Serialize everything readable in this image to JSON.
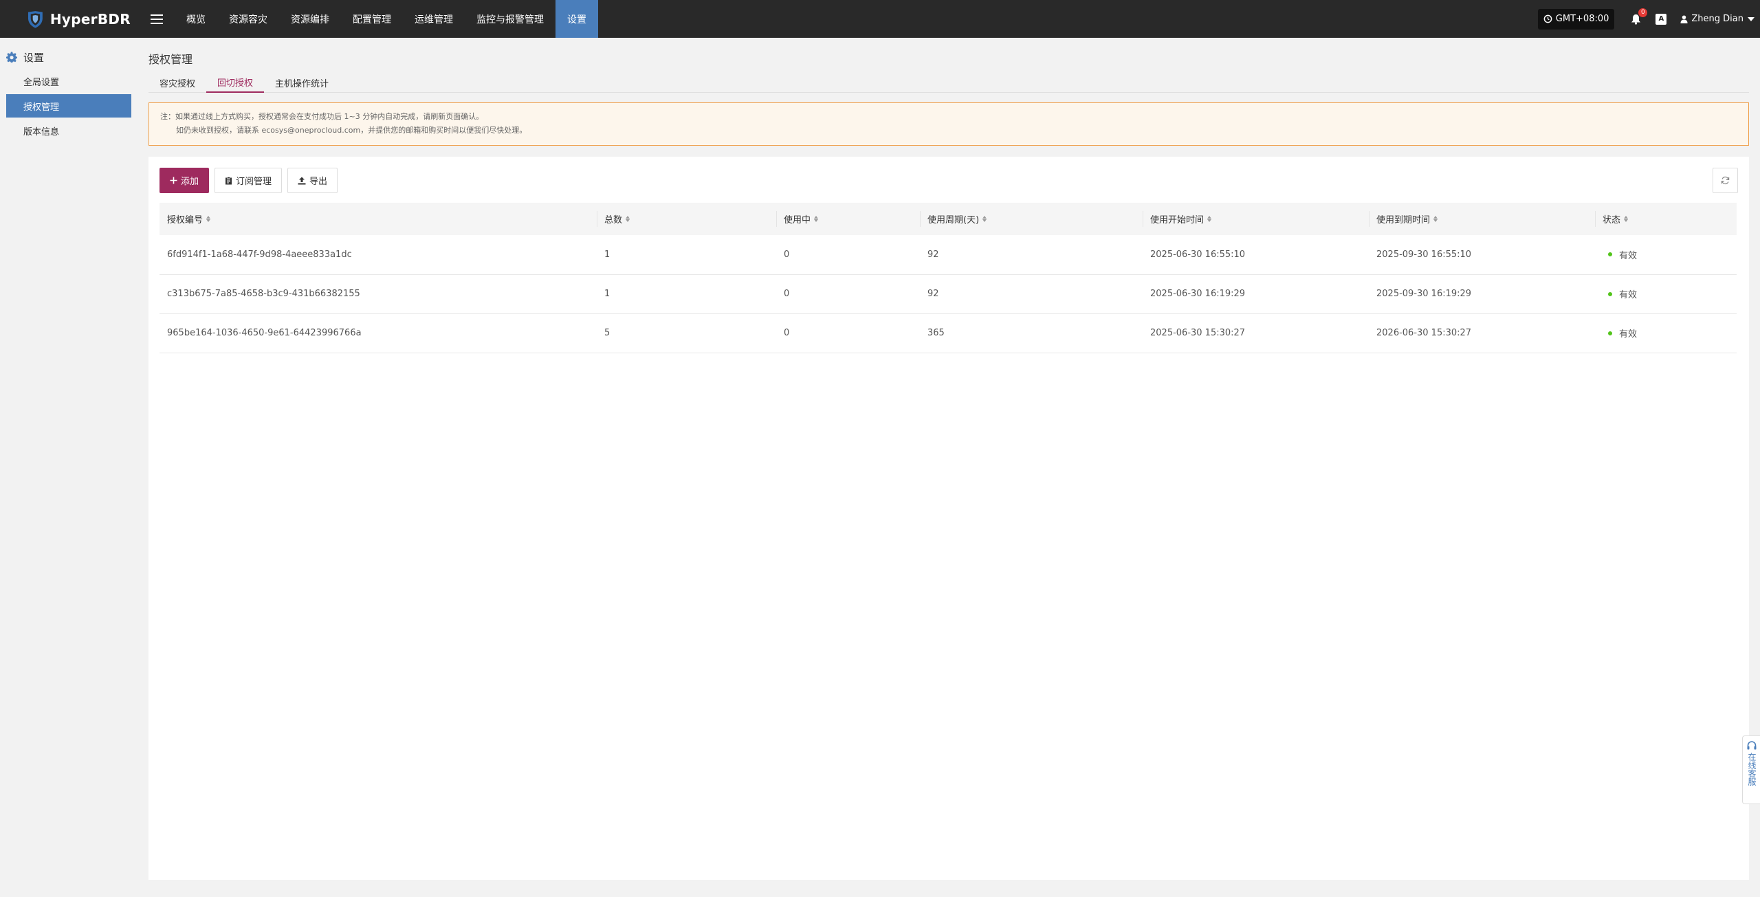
{
  "app": {
    "brand": "HyperBDR",
    "colors": {
      "topbar": "#292929",
      "active_nav": "#4a7ebb",
      "accent": "#9e2a5e",
      "status_ok": "#52c41a"
    }
  },
  "nav": {
    "items": [
      {
        "label": "概览"
      },
      {
        "label": "资源容灾"
      },
      {
        "label": "资源编排"
      },
      {
        "label": "配置管理"
      },
      {
        "label": "运维管理"
      },
      {
        "label": "监控与报警管理"
      },
      {
        "label": "设置",
        "active": true
      }
    ]
  },
  "topright": {
    "timezone": "GMT+08:00",
    "notifications": "0",
    "lang": "A",
    "user": "Zheng Dian"
  },
  "sidebar": {
    "title": "设置",
    "items": [
      {
        "label": "全局设置"
      },
      {
        "label": "授权管理",
        "active": true
      },
      {
        "label": "版本信息"
      }
    ]
  },
  "page": {
    "title": "授权管理",
    "tabs": [
      {
        "label": "容灾授权"
      },
      {
        "label": "回切授权",
        "active": true
      },
      {
        "label": "主机操作统计"
      }
    ],
    "notice": {
      "line1": "注：如果通过线上方式购买，授权通常会在支付成功后 1~3 分钟内自动完成，请刷新页面确认。",
      "line2": "如仍未收到授权，请联系 ecosys@oneprocloud.com，并提供您的邮箱和购买时间以便我们尽快处理。"
    }
  },
  "toolbar": {
    "add": "添加",
    "subscription": "订阅管理",
    "export": "导出"
  },
  "table": {
    "columns": [
      "授权编号",
      "总数",
      "使用中",
      "使用周期(天)",
      "使用开始时间",
      "使用到期时间",
      "状态"
    ],
    "rows": [
      [
        "6fd914f1-1a68-447f-9d98-4aeee833a1dc",
        "1",
        "0",
        "92",
        "2025-06-30 16:55:10",
        "2025-09-30 16:55:10",
        "有效"
      ],
      [
        "c313b675-7a85-4658-b3c9-431b66382155",
        "1",
        "0",
        "92",
        "2025-06-30 16:19:29",
        "2025-09-30 16:19:29",
        "有效"
      ],
      [
        "965be164-1036-4650-9e61-64423996766a",
        "5",
        "0",
        "365",
        "2025-06-30 15:30:27",
        "2026-06-30 15:30:27",
        "有效"
      ]
    ]
  },
  "service": {
    "label": "在线客服"
  }
}
